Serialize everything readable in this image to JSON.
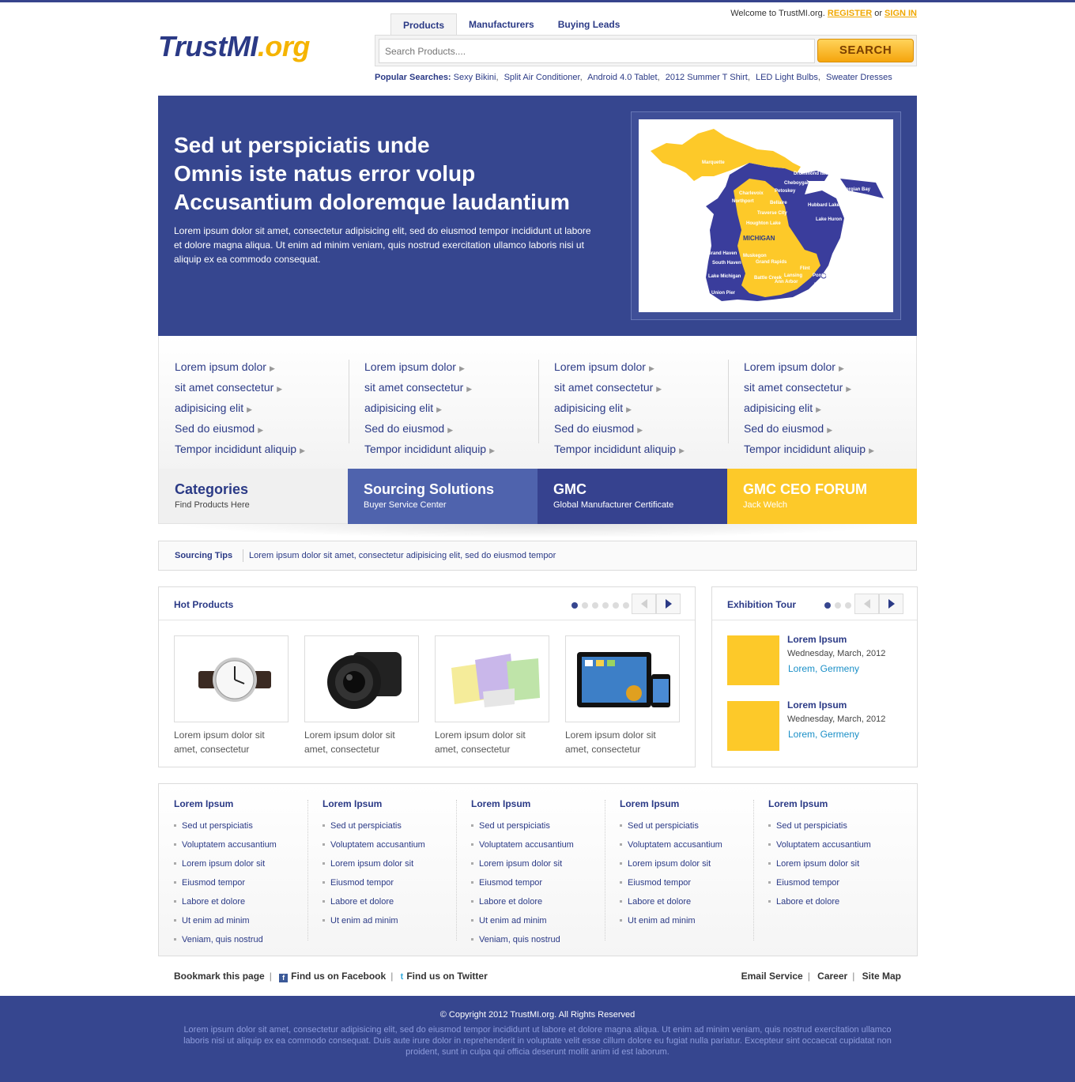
{
  "header": {
    "logo_main": "TrustMI",
    "logo_ext": ".org",
    "welcome": "Welcome to TrustMI.org.",
    "register": "REGISTER",
    "or": "or",
    "signin": "SIGN IN",
    "tabs": [
      {
        "label": "Products",
        "active": true
      },
      {
        "label": "Manufacturers",
        "active": false
      },
      {
        "label": "Buying Leads",
        "active": false
      }
    ],
    "search_placeholder": "Search Products....",
    "search_button": "SEARCH",
    "popular_label": "Popular Searches:",
    "popular": [
      "Sexy Bikini",
      "Split Air Conditioner",
      "Android 4.0 Tablet",
      "2012 Summer T Shirt",
      "LED Light Bulbs",
      "Sweater Dresses"
    ]
  },
  "hero": {
    "title_lines": [
      "Sed ut perspiciatis unde",
      "Omnis iste natus error volup",
      "Accusantium doloremque laudantium"
    ],
    "text": "Lorem ipsum dolor sit amet, consectetur adipisicing elit, sed do eiusmod tempor incididunt ut labore et dolore magna aliqua. Ut enim ad minim veniam, quis nostrud exercitation ullamco laboris nisi ut aliquip ex ea commodo consequat.",
    "map_labels": [
      "Marquette",
      "Drummond Island",
      "Cheboygan",
      "Georgian Bay",
      "Petoskey",
      "Charlevoix",
      "Northport",
      "Bellaire",
      "Hubbard Lake",
      "Traverse City",
      "Lake Huron",
      "Houghton Lake",
      "MICHIGAN",
      "Grand Haven",
      "Muskegon",
      "South Haven",
      "Grand Rapids",
      "Lake Michigan",
      "Battle Creek",
      "Flint",
      "Lansing",
      "Pontiac",
      "Ann Arbor",
      "Detroit",
      "Union Pier"
    ]
  },
  "link_columns": [
    [
      "Lorem ipsum dolor",
      "sit amet consectetur",
      "adipisicing elit",
      "Sed do eiusmod",
      "Tempor incididunt aliquip"
    ],
    [
      "Lorem ipsum dolor",
      "sit amet consectetur",
      "adipisicing elit",
      "Sed do eiusmod",
      "Tempor incididunt aliquip"
    ],
    [
      "Lorem ipsum dolor",
      "sit amet consectetur",
      "adipisicing elit",
      "Sed do eiusmod",
      "Tempor incididunt aliquip"
    ],
    [
      "Lorem ipsum dolor",
      "sit amet consectetur",
      "adipisicing elit",
      "Sed do eiusmod",
      "Tempor incididunt aliquip"
    ]
  ],
  "tiles": [
    {
      "title": "Categories",
      "sub": "Find Products Here"
    },
    {
      "title": "Sourcing Solutions",
      "sub": "Buyer Service Center"
    },
    {
      "title": "GMC",
      "sub": "Global Manufacturer Certificate"
    },
    {
      "title": "GMC CEO FORUM",
      "sub": "Jack Welch"
    }
  ],
  "tips": {
    "label": "Sourcing Tips",
    "text": "Lorem ipsum dolor sit amet, consectetur adipisicing elit, sed do eiusmod tempor"
  },
  "hot_products": {
    "title": "Hot Products",
    "dot_count": 6,
    "active_dot": 0,
    "items": [
      {
        "caption": "Lorem ipsum dolor sit amet, consectetur",
        "icon": "watch"
      },
      {
        "caption": "Lorem ipsum dolor sit amet, consectetur",
        "icon": "camera"
      },
      {
        "caption": "Lorem ipsum dolor sit amet, consectetur",
        "icon": "diapers"
      },
      {
        "caption": "Lorem ipsum dolor sit amet, consectetur",
        "icon": "tablet-phone"
      }
    ]
  },
  "exhibition": {
    "title": "Exhibition Tour",
    "dot_count": 3,
    "active_dot": 0,
    "events": [
      {
        "title": "Lorem Ipsum",
        "date": "Wednesday, March, 2012",
        "location": "Lorem, Germeny"
      },
      {
        "title": "Lorem Ipsum",
        "date": "Wednesday, March, 2012",
        "location": "Lorem, Germeny"
      }
    ]
  },
  "bottom_columns": [
    {
      "heading": "Lorem Ipsum",
      "items": [
        "Sed ut perspiciatis",
        "Voluptatem accusantium",
        "Lorem ipsum dolor sit",
        "Eiusmod tempor",
        "Labore et dolore",
        "Ut enim ad minim",
        "Veniam, quis nostrud"
      ]
    },
    {
      "heading": "Lorem Ipsum",
      "items": [
        "Sed ut perspiciatis",
        "Voluptatem accusantium",
        "Lorem ipsum dolor sit",
        "Eiusmod tempor",
        "Labore et dolore",
        "Ut enim ad minim"
      ]
    },
    {
      "heading": "Lorem Ipsum",
      "items": [
        "Sed ut perspiciatis",
        "Voluptatem accusantium",
        "Lorem ipsum dolor sit",
        "Eiusmod tempor",
        "Labore et dolore",
        "Ut enim ad minim",
        "Veniam, quis nostrud"
      ]
    },
    {
      "heading": "Lorem Ipsum",
      "items": [
        "Sed ut perspiciatis",
        "Voluptatem accusantium",
        "Lorem ipsum dolor sit",
        "Eiusmod tempor",
        "Labore et dolore",
        "Ut enim ad minim"
      ]
    },
    {
      "heading": "Lorem Ipsum",
      "items": [
        "Sed ut perspiciatis",
        "Voluptatem accusantium",
        "Lorem ipsum dolor sit",
        "Eiusmod tempor",
        "Labore et dolore"
      ]
    }
  ],
  "footer_links": {
    "bookmark": "Bookmark this page",
    "facebook": "Find us on Facebook",
    "twitter": "Find us on Twitter",
    "right": [
      "Email Service",
      "Career",
      "Site Map"
    ]
  },
  "footer": {
    "copyright": "© Copyright 2012 TrustMI.org. All Rights Reserved",
    "text": "Lorem ipsum dolor sit amet, consectetur adipisicing elit, sed do eiusmod tempor incididunt ut labore et dolore magna aliqua. Ut enim ad minim veniam, quis nostrud exercitation ullamco laboris nisi ut aliquip ex ea commodo consequat. Duis aute irure dolor in reprehenderit in voluptate velit esse cillum dolore eu fugiat nulla pariatur. Excepteur sint occaecat cupidatat non proident, sunt in culpa qui officia deserunt mollit anim id est laborum."
  },
  "colors": {
    "brand_blue": "#36468f",
    "accent_yellow": "#fdc929",
    "link_blue": "#2b3a86"
  }
}
